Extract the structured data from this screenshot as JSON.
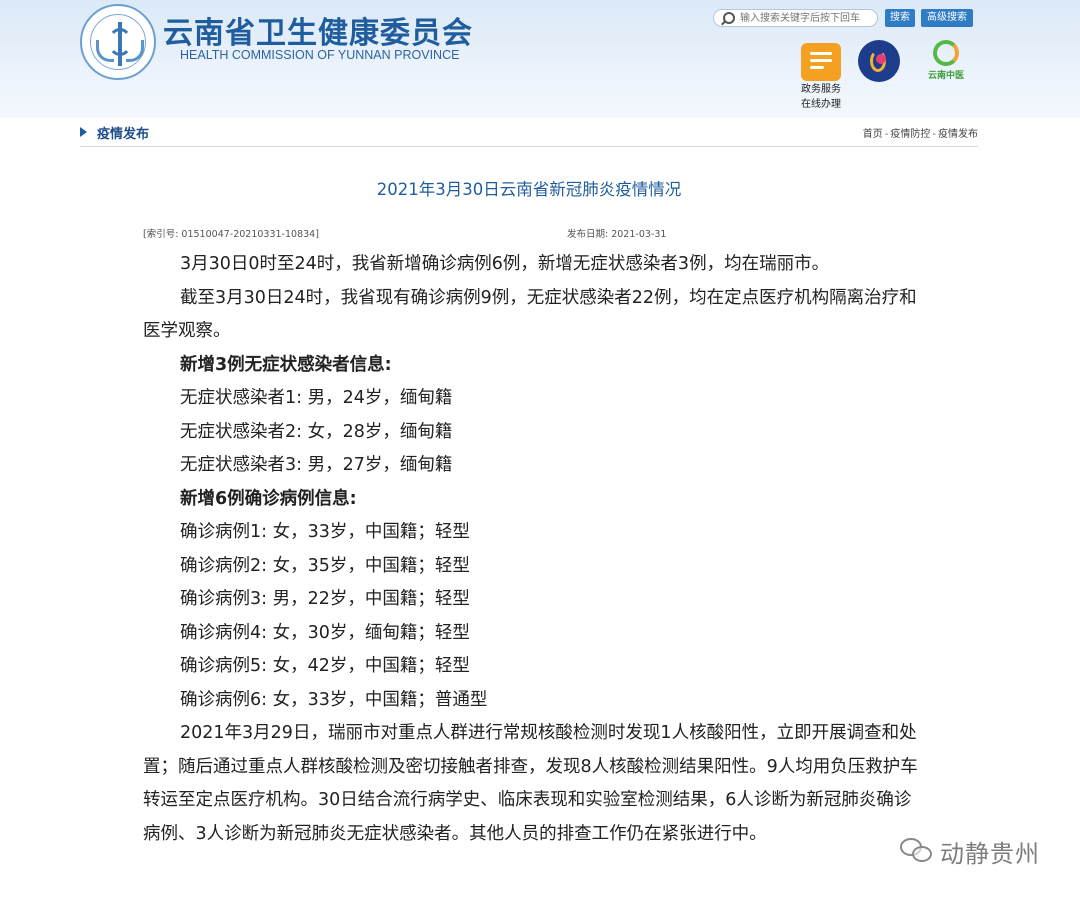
{
  "header": {
    "title": "云南省卫生健康委员会",
    "subtitle": "HEALTH COMMISSION OF YUNNAN PROVINCE",
    "search_placeholder": "输入搜索关键字后按下回车",
    "search_button": "搜索",
    "advanced_search_button": "高级搜索",
    "service_label_line1": "政务服务",
    "service_label_line2": "在线办理",
    "yunnan_tcm_label": "云南中医"
  },
  "nav": {
    "section_title": "疫情发布",
    "breadcrumb": [
      "首页",
      "疫情防控",
      "疫情发布"
    ],
    "separator": "-"
  },
  "article": {
    "title": "2021年3月30日云南省新冠肺炎疫情情况",
    "index_no": "[索引号: 01510047-20210331-10834]",
    "publish_date": "发布日期: 2021-03-31",
    "paragraphs": [
      "3月30日0时至24时，我省新增确诊病例6例，新增无症状感染者3例，均在瑞丽市。",
      "截至3月30日24时，我省现有确诊病例9例，无症状感染者22例，均在定点医疗机构隔离治疗和医学观察。"
    ],
    "asymptomatic_heading": "新增3例无症状感染者信息:",
    "asymptomatic_items": [
      "无症状感染者1: 男，24岁，缅甸籍",
      "无症状感染者2: 女，28岁，缅甸籍",
      "无症状感染者3: 男，27岁，缅甸籍"
    ],
    "confirmed_heading": "新增6例确诊病例信息:",
    "confirmed_items": [
      "确诊病例1: 女，33岁，中国籍；轻型",
      "确诊病例2: 女，35岁，中国籍；轻型",
      "确诊病例3: 男，22岁，中国籍；轻型",
      "确诊病例4: 女，30岁，缅甸籍；轻型",
      "确诊病例5: 女，42岁，中国籍；轻型",
      "确诊病例6: 女，33岁，中国籍；普通型"
    ],
    "closing_paragraph": "2021年3月29日，瑞丽市对重点人群进行常规核酸检测时发现1人核酸阳性，立即开展调查和处置；随后通过重点人群核酸检测及密切接触者排查，发现8人核酸检测结果阳性。9人均用负压救护车转运至定点医疗机构。30日结合流行病学史、临床表现和实验室检测结果，6人诊断为新冠肺炎确诊病例、3人诊断为新冠肺炎无症状感染者。其他人员的排查工作仍在紧张进行中。"
  },
  "watermark": {
    "text": "动静贵州"
  },
  "icons": {
    "emblem": "health-commission-emblem",
    "search": "search-icon",
    "service": "government-service-icon",
    "logo2": "provincial-logo",
    "logo3": "yunnan-tcm-logo",
    "watermark": "wechat-icon"
  },
  "colors": {
    "brand_blue": "#1f5d9e",
    "button_blue": "#2f7bc4",
    "service_orange": "#f4a020"
  }
}
